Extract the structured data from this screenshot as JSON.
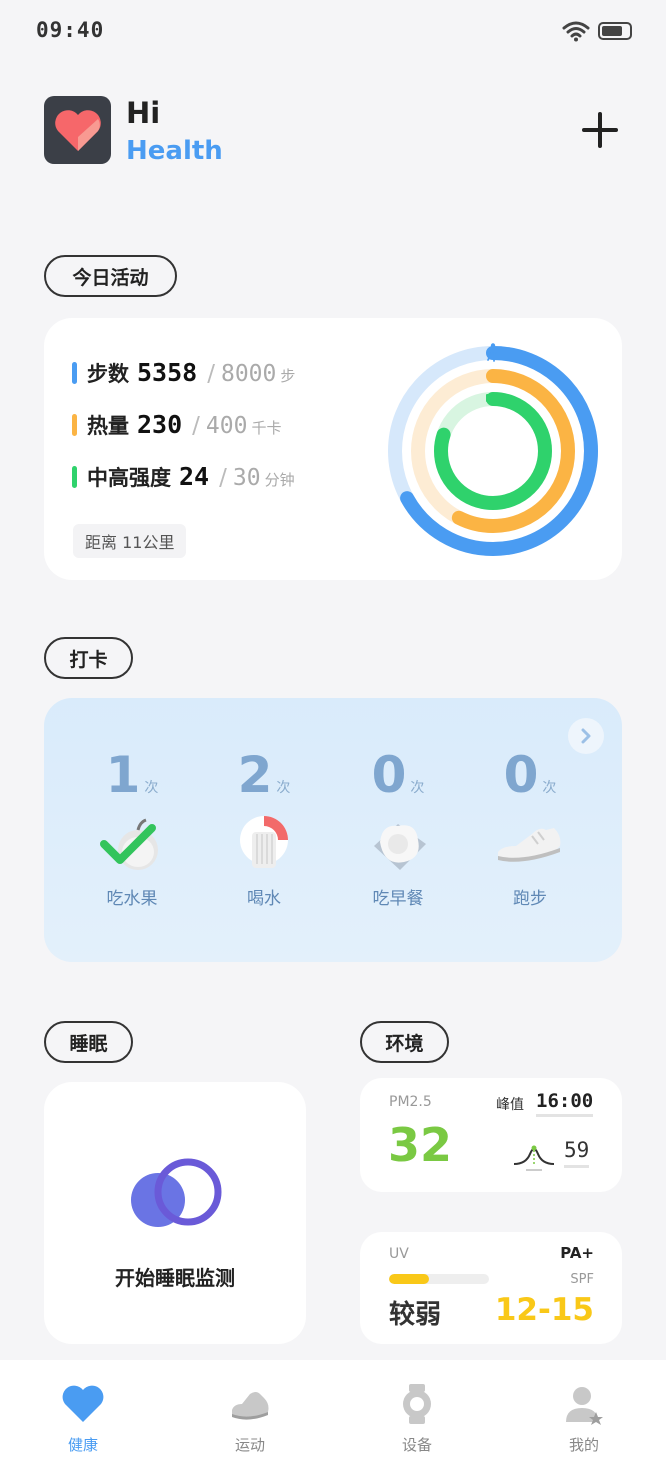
{
  "status_bar": {
    "time": "09:40"
  },
  "header": {
    "hi": "Hi",
    "health": "Health"
  },
  "sections": {
    "activity": "今日活动",
    "checkin": "打卡",
    "sleep": "睡眠",
    "environment": "环境"
  },
  "activity": {
    "steps": {
      "label": "步数",
      "value": "5358",
      "goal": "8000",
      "unit": "步",
      "color": "#4a9cf2"
    },
    "calories": {
      "label": "热量",
      "value": "230",
      "goal": "400",
      "unit": "千卡",
      "color": "#fbb444"
    },
    "intensity": {
      "label": "中高强度",
      "value": "24",
      "goal": "30",
      "unit": "分钟",
      "color": "#2fd26c"
    },
    "distance": "距离  11公里",
    "slash": "/"
  },
  "checkin": {
    "items": [
      {
        "count": "1",
        "unit": "次",
        "label": "吃水果",
        "icon": "apple-check-icon"
      },
      {
        "count": "2",
        "unit": "次",
        "label": "喝水",
        "icon": "water-cup-icon"
      },
      {
        "count": "0",
        "unit": "次",
        "label": "吃早餐",
        "icon": "fried-egg-icon"
      },
      {
        "count": "0",
        "unit": "次",
        "label": "跑步",
        "icon": "running-shoe-icon"
      }
    ]
  },
  "sleep": {
    "label": "开始睡眠监测"
  },
  "environment": {
    "pm_label": "PM2.5",
    "pm_value": "32",
    "peak_label": "峰值",
    "peak_time": "16:00",
    "peak_value": "59",
    "uv_label": "UV",
    "pa_label": "PA+",
    "spf_label": "SPF",
    "uv_level": "较弱",
    "spf_value": "12-15",
    "uv_fraction": 0.4
  },
  "tabs": [
    {
      "label": "健康",
      "icon": "heart-icon",
      "active": true
    },
    {
      "label": "运动",
      "icon": "shoe-icon",
      "active": false
    },
    {
      "label": "设备",
      "icon": "watch-icon",
      "active": false
    },
    {
      "label": "我的",
      "icon": "user-icon",
      "active": false
    }
  ]
}
